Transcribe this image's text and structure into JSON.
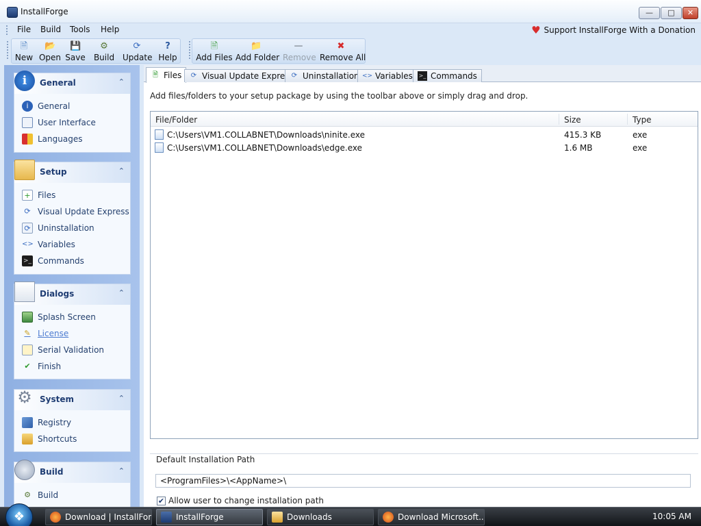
{
  "window": {
    "title": "InstallForge"
  },
  "menu": [
    "File",
    "Build",
    "Tools",
    "Help"
  ],
  "support": {
    "text": "Support InstallForge With a Donation"
  },
  "toolbar": {
    "new": "New",
    "open": "Open",
    "save": "Save",
    "build": "Build",
    "update": "Update",
    "help": "Help",
    "add_files": "Add Files",
    "add_folder": "Add Folder",
    "remove": "Remove",
    "remove_all": "Remove All"
  },
  "sidebar": {
    "general": {
      "title": "General",
      "items": [
        "General",
        "User Interface",
        "Languages"
      ]
    },
    "setup": {
      "title": "Setup",
      "items": [
        "Files",
        "Visual Update Express",
        "Uninstallation",
        "Variables",
        "Commands"
      ]
    },
    "dialogs": {
      "title": "Dialogs",
      "items": [
        "Splash Screen",
        "License",
        "Serial Validation",
        "Finish"
      ]
    },
    "system": {
      "title": "System",
      "items": [
        "Registry",
        "Shortcuts"
      ]
    },
    "build": {
      "title": "Build",
      "items": [
        "Build"
      ]
    }
  },
  "tabs": [
    "Files",
    "Visual Update Express",
    "Uninstallation",
    "Variables",
    "Commands"
  ],
  "files": {
    "instructions": "Add files/folders to your setup package by using the toolbar above or simply drag and drop.",
    "columns": [
      "File/Folder",
      "Size",
      "Type"
    ],
    "rows": [
      {
        "path": "C:\\Users\\VM1.COLLABNET\\Downloads\\ninite.exe",
        "size": "415.3 KB",
        "type": "exe"
      },
      {
        "path": "C:\\Users\\VM1.COLLABNET\\Downloads\\edge.exe",
        "size": "1.6 MB",
        "type": "exe"
      }
    ]
  },
  "install_path": {
    "legend": "Default Installation Path",
    "value": "<ProgramFiles>\\<AppName>\\",
    "allow_change_label": "Allow user to change installation path",
    "allow_change_checked": true
  },
  "taskbar": {
    "tasks": [
      "Download | InstallFor...",
      "InstallForge",
      "Downloads",
      "Download Microsoft..."
    ],
    "clock": "10:05 AM"
  }
}
